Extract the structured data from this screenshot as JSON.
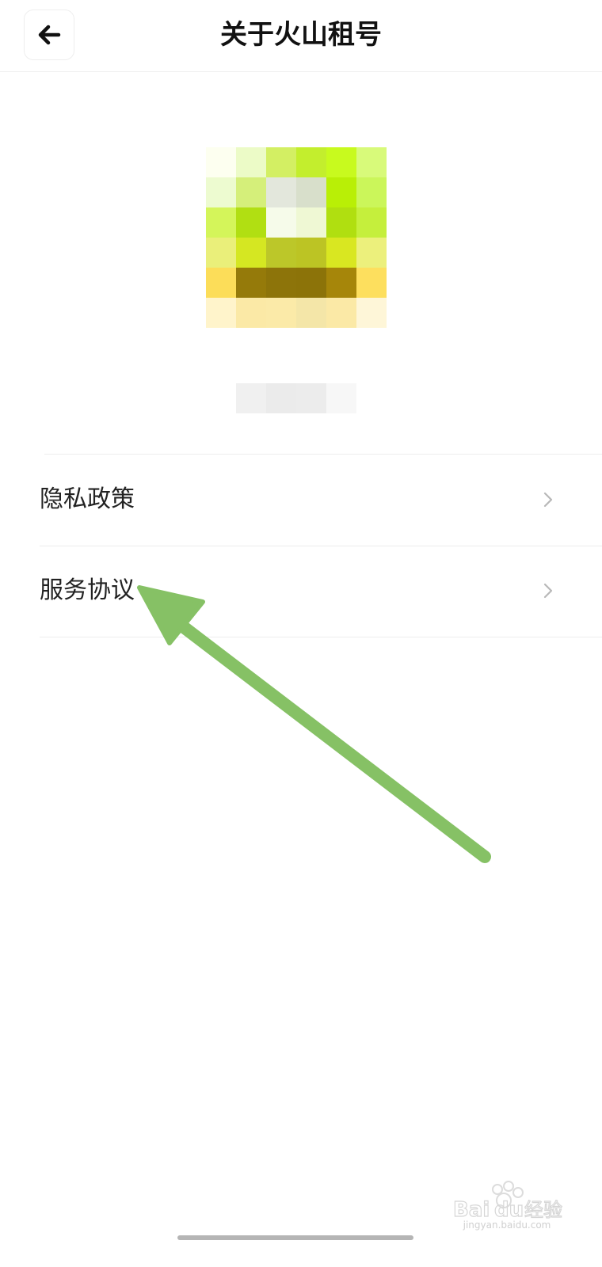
{
  "header": {
    "title": "关于火山租号",
    "back_icon": "arrow-left-icon"
  },
  "menu": {
    "items": [
      {
        "label": "隐私政策",
        "icon": "chevron-right-icon"
      },
      {
        "label": "服务协议",
        "icon": "chevron-right-icon"
      }
    ]
  },
  "watermark": {
    "text": "jingyan.baidu.com"
  },
  "colors": {
    "annotation_arrow": "#86c165",
    "chevron": "#b8b8b8",
    "divider": "#ededed"
  }
}
